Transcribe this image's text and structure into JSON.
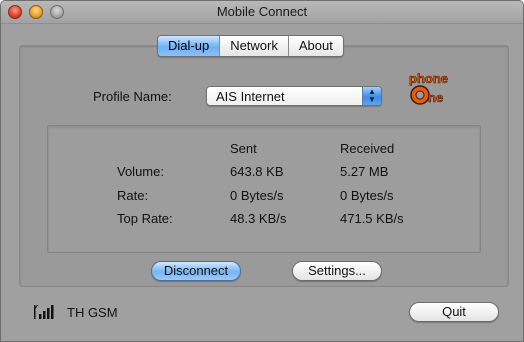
{
  "window": {
    "title": "Mobile Connect"
  },
  "tabs": [
    {
      "label": "Dial-up",
      "active": true
    },
    {
      "label": "Network",
      "active": false
    },
    {
      "label": "About",
      "active": false
    }
  ],
  "profile": {
    "label": "Profile Name:",
    "selected": "AIS Internet"
  },
  "logo": {
    "text_top": "phone",
    "text_bottom": "One"
  },
  "stats": {
    "headers": {
      "sent": "Sent",
      "received": "Received"
    },
    "rows": [
      {
        "label": "Volume:",
        "sent": "643.8 KB",
        "received": "5.27 MB"
      },
      {
        "label": "Rate:",
        "sent": "0 Bytes/s",
        "received": "0 Bytes/s"
      },
      {
        "label": "Top Rate:",
        "sent": "48.3 KB/s",
        "received": "471.5 KB/s"
      }
    ]
  },
  "buttons": {
    "disconnect": "Disconnect",
    "settings": "Settings...",
    "quit": "Quit"
  },
  "status": {
    "network": "TH GSM",
    "signal_icon": "signal-bars-icon"
  },
  "colors": {
    "window_bg": "#a0a0a0",
    "accent_blue": "#6fb0f5",
    "logo_orange": "#e85a10"
  }
}
